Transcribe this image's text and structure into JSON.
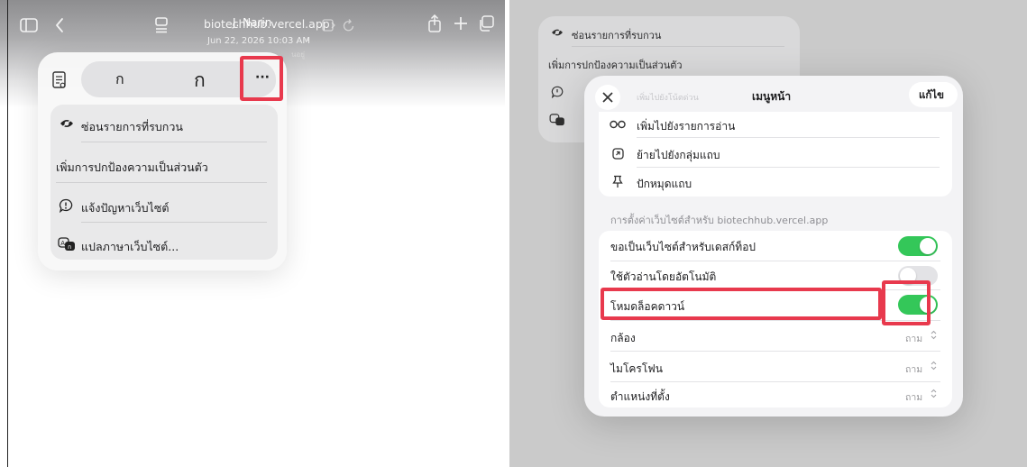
{
  "left": {
    "toolbar": {
      "site_title": "biotechhub.vercel.app",
      "overlay_name": "J. Narin",
      "timestamp": "Jun 22, 2026 10:03 AM",
      "overlay_fragment": "นอยู่",
      "icons": [
        "sidebar-icon",
        "back-chevron-icon",
        "page-settings-icon",
        "extension-icon",
        "reload-icon",
        "share-icon",
        "plus-icon",
        "tabs-icon"
      ]
    },
    "font_row": {
      "smaller_label": "ก",
      "larger_label": "ก",
      "more_label": "···"
    },
    "menu": {
      "items": [
        {
          "icon": "hide-distractions-icon",
          "label": "ซ่อนรายการที่รบกวน"
        },
        {
          "icon": "",
          "label": "เพิ่มการปกป้องความเป็นส่วนตัว"
        },
        {
          "icon": "report-issue-icon",
          "label": "แจ้งปัญหาเว็บไซต์"
        },
        {
          "icon": "translate-icon",
          "label": "แปลภาษาเว็บไซต์..."
        }
      ]
    }
  },
  "right": {
    "background_menu": {
      "items": [
        "ซ่อนรายการที่รบกวน",
        "เพิ่มการปกป้องความเป็นส่วนตัว"
      ]
    },
    "sheet": {
      "title": "เมนูหน้า",
      "faded_title": "เพิ่มไปยังโน้ตด่วน",
      "edit_label": "แก้ไข",
      "actions": [
        {
          "icon": "reading-list-icon",
          "label": "เพิ่มไปยังรายการอ่าน"
        },
        {
          "icon": "move-to-tab-group-icon",
          "label": "ย้ายไปยังกลุ่มแถบ"
        },
        {
          "icon": "pin-icon",
          "label": "ปักหมุดแถบ"
        }
      ],
      "settings_header": "การตั้งค่าเว็บไซต์สำหรับ biotechhub.vercel.app",
      "settings": [
        {
          "label": "ขอเป็นเว็บไซต์สำหรับเดสก์ท็อป",
          "type": "toggle",
          "on": true
        },
        {
          "label": "ใช้ตัวอ่านโดยอัตโนมัติ",
          "type": "toggle",
          "on": false
        },
        {
          "label": "โหมดล็อคดาวน์",
          "type": "toggle",
          "on": true
        },
        {
          "label": "กล้อง",
          "type": "select",
          "value": "ถาม"
        },
        {
          "label": "ไมโครโฟน",
          "type": "select",
          "value": "ถาม"
        },
        {
          "label": "ตำแหน่งที่ตั้ง",
          "type": "select",
          "value": "ถาม"
        }
      ]
    }
  },
  "colors": {
    "toggle_on": "#34c759",
    "highlight": "#e8394d"
  }
}
